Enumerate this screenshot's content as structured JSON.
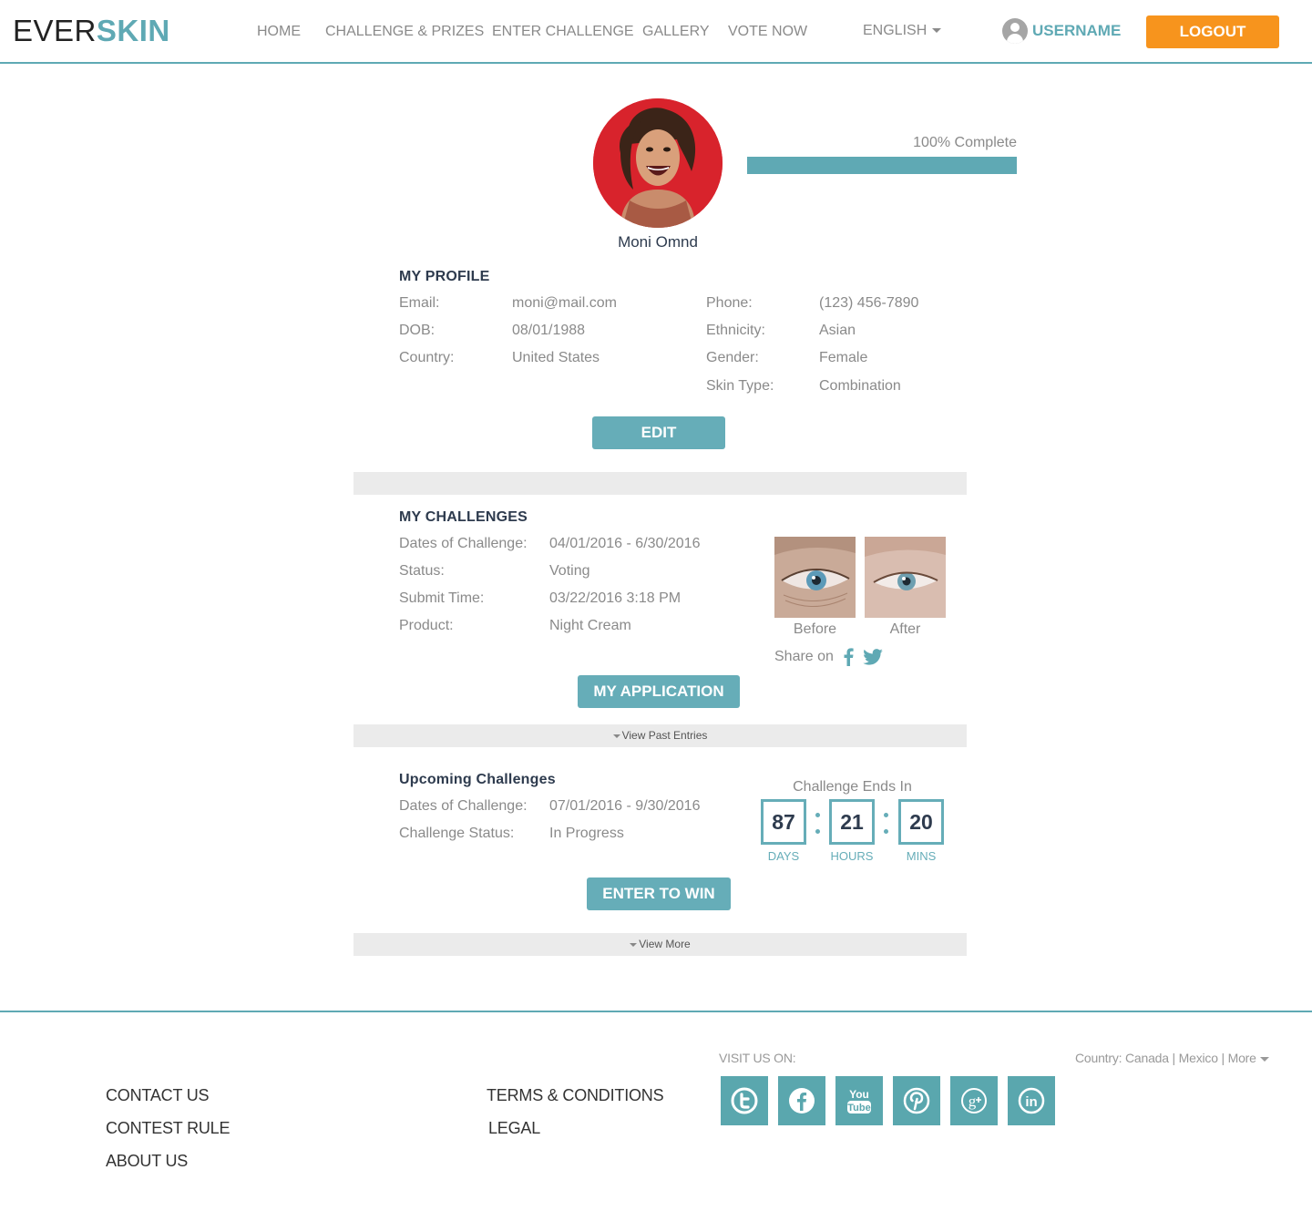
{
  "header": {
    "logo_part1": "EVER",
    "logo_part2": "SKIN",
    "nav": [
      "HOME",
      "CHALLENGE & PRIZES",
      "ENTER CHALLENGE",
      "GALLERY",
      "VOTE NOW"
    ],
    "language": "ENGLISH",
    "username": "USERNAME",
    "logout": "LOGOUT"
  },
  "profile": {
    "name": "Moni Omnd",
    "progress_label": "100% Complete",
    "progress_fraction": 1.0,
    "section_title": "MY PROFILE",
    "left_fields": [
      {
        "label": "Email:",
        "value": "moni@mail.com"
      },
      {
        "label": "DOB:",
        "value": "08/01/1988"
      },
      {
        "label": "Country:",
        "value": "United States"
      }
    ],
    "right_fields": [
      {
        "label": "Phone:",
        "value": "(123) 456-7890"
      },
      {
        "label": "Ethnicity:",
        "value": "Asian"
      },
      {
        "label": "Gender:",
        "value": "Female"
      },
      {
        "label": "Skin Type:",
        "value": "Combination"
      }
    ],
    "edit_button": "EDIT"
  },
  "challenges": {
    "section_title": "MY CHALLENGES",
    "fields": [
      {
        "label": "Dates of Challenge:",
        "value": "04/01/2016 - 6/30/2016"
      },
      {
        "label": "Status:",
        "value": "Voting"
      },
      {
        "label": "Submit Time:",
        "value": "03/22/2016  3:18 PM"
      },
      {
        "label": "Product:",
        "value": "Night Cream"
      }
    ],
    "before_label": "Before",
    "after_label": "After",
    "share_label": "Share on",
    "application_button": "MY APPLICATION",
    "view_past": "View Past Entries"
  },
  "upcoming": {
    "section_title": "Upcoming Challenges",
    "fields": [
      {
        "label": "Dates of Challenge:",
        "value": "07/01/2016 - 9/30/2016"
      },
      {
        "label": "Challenge Status:",
        "value": "In Progress"
      }
    ],
    "countdown_title": "Challenge Ends In",
    "days": "87",
    "hours": "21",
    "mins": "20",
    "days_label": "DAYS",
    "hours_label": "HOURS",
    "mins_label": "MINS",
    "enter_button": "ENTER TO WIN",
    "view_more": "View More"
  },
  "footer": {
    "links_left": [
      "CONTACT US",
      "CONTEST RULE",
      "ABOUT US"
    ],
    "links_mid": [
      "TERMS & CONDITIONS",
      "LEGAL"
    ],
    "visit_label": "VISIT US ON:",
    "country_label": "Country: Canada | Mexico | More",
    "social_icons": [
      "twitter-icon",
      "facebook-icon",
      "youtube-icon",
      "pinterest-icon",
      "google-plus-icon",
      "linkedin-icon"
    ]
  },
  "colors": {
    "accent": "#5fa9b4",
    "button": "#66adb8",
    "logout": "#f7941d",
    "heading": "#2e3b4e"
  }
}
